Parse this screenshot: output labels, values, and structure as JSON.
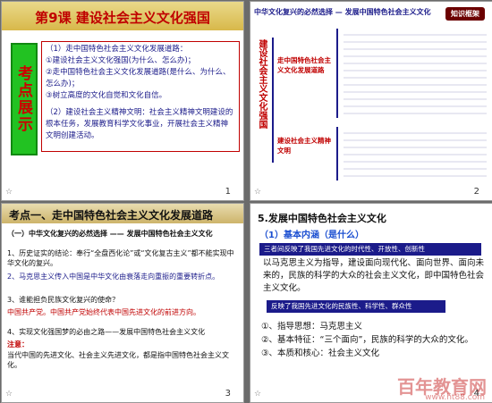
{
  "slide1": {
    "title": "第9课 建设社会主义文化强国",
    "side": "考点展示",
    "p1": "（1）走中国特色社会主义文化发展道路：",
    "p2": "①建设社会主义文化强国(为什么、怎么办)；",
    "p3": "②走中国特色社会主义文化发展道路(是什么、为什么、怎么办)；",
    "p4": "③树立高度的文化自觉和文化自信。",
    "p5": "（2）建设社会主义精神文明：社会主义精神文明建设的根本任务，发展教育科学文化事业，开展社会主义精神文明创建活动。",
    "num": "1"
  },
  "slide2": {
    "badge": "知识框架",
    "top": "中华文化复兴的必然选择 — 发展中国特色社会主义文化",
    "vt": "建设社会主义文化强国",
    "g1": "走中国特色社会主义文化发展道路",
    "g2": "建设社会主义精神文明",
    "num": "2"
  },
  "slide3": {
    "title": "考点一、走中国特色社会主义文化发展道路",
    "s1": "（一）中华文化复兴的必然选择 —— 发展中国特色社会主义文化",
    "s2": "1、历史证实的结论：奉行“全盘西化论”或“文化复古主义”都不能实现中华文化的复兴。",
    "s3": "2、马克思主义传入中国是中华文化由衰落走向重振的重要转折点。",
    "s4": "3、谁能担负民族文化复兴的使命？",
    "s5": "中国共产党。中国共产党始终代表中国先进文化的前进方向。",
    "s6": "4、实现文化强国梦的必由之路——发展中国特色社会主义文化",
    "s7": "注意：",
    "s8": "当代中国的先进文化、社会主义先进文化，都是指中国特色社会主义文化。",
    "num": "3"
  },
  "slide4": {
    "title": "5.发展中国特色社会主义文化",
    "sub": "（1）基本内涵（是什么）",
    "bar1": "三者间反映了我国先进文化的时代性、开放性、创新性",
    "para": "以马克思主义为指导，建设面向现代化、面向世界、面向未来的，民族的科学的大众的社会主义文化，即中国特色社会主义文化。",
    "bar2": "反映了我国先进文化的民族性、科学性、群众性",
    "l1": "①、指导思想：马克思主义",
    "l2": "②、基本特征：“三个面向”，民族的科学的大众的文化。",
    "l3": "③、本质和核心：社会主义文化",
    "num": "4"
  },
  "watermark": "百年教育网",
  "watermark_url": "www.ht88.com"
}
